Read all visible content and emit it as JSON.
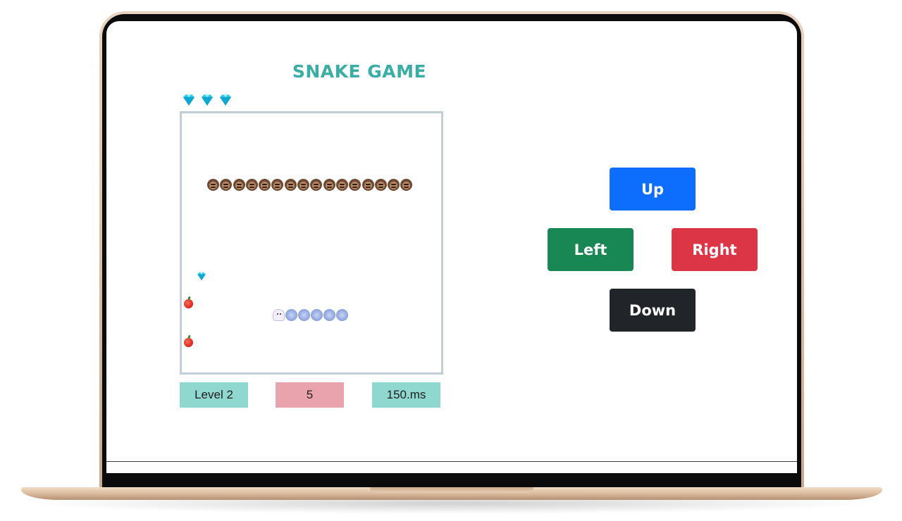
{
  "game": {
    "title": "SNAKE GAME",
    "lives_count": 3,
    "lives_icon": "diamond-icon",
    "stats": {
      "level": "Level 2",
      "score": "5",
      "speed": "150.ms"
    },
    "controls": {
      "up": "Up",
      "left": "Left",
      "right": "Right",
      "down": "Down"
    },
    "colors": {
      "title": "#3aaea4",
      "up": "#0d6efd",
      "left": "#198754",
      "right": "#dc3545",
      "down": "#212529",
      "level_bg": "#8fd8cf",
      "score_bg": "#e9a3ad",
      "speed_bg": "#8fd8cf",
      "board_border": "#c2cdd8"
    },
    "board": {
      "enemy_snake_segments": 16,
      "enemy_snake_icon": "bearded-face-icon",
      "player_snake_head_icon": "ghost-icon",
      "player_snake_body_segments": 5,
      "player_snake_body_icon": "blue-ball-icon",
      "items": [
        "diamond-icon",
        "apple-icon",
        "apple-icon"
      ]
    }
  }
}
